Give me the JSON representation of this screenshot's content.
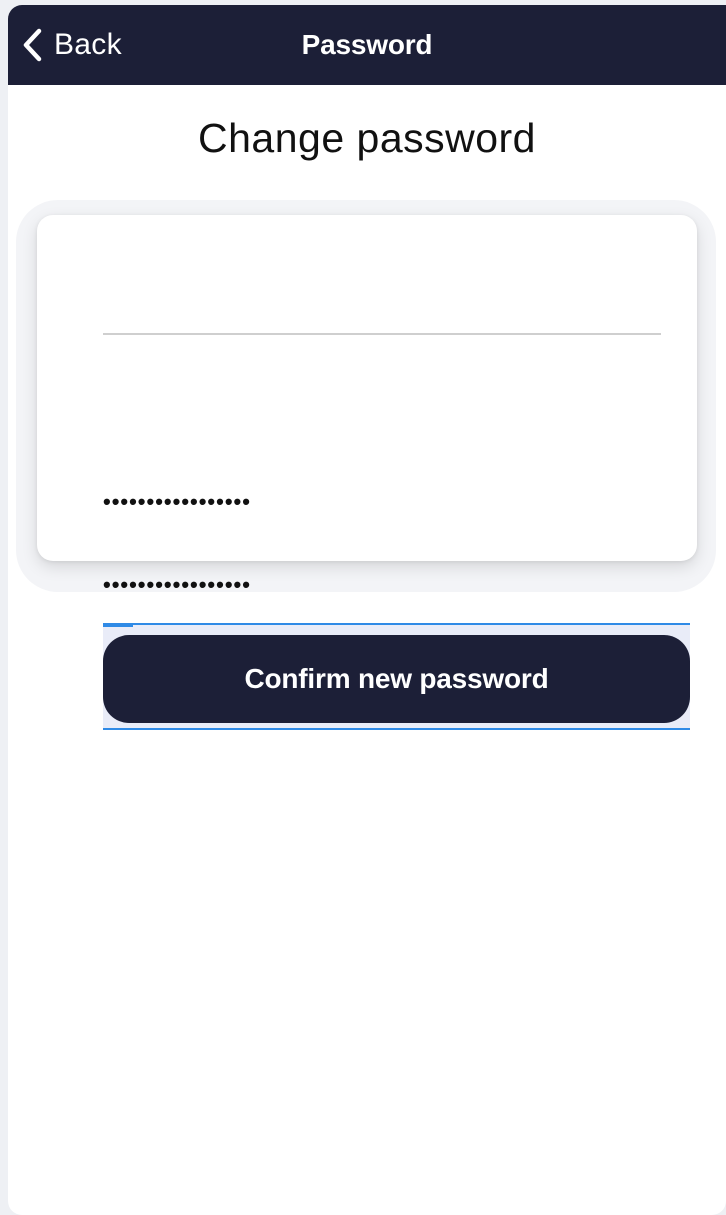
{
  "navbar": {
    "back_label": "Back",
    "title": "Password",
    "background": "#1c1f37"
  },
  "page": {
    "heading": "Change password"
  },
  "form": {
    "password_field_1": {
      "value": "•••••••••••••••••"
    },
    "password_field_2": {
      "value": "•••••••••••••••••"
    },
    "confirm_label": "Confirm new password"
  },
  "icons": {
    "back": "chevron-left-icon"
  },
  "colors": {
    "primary": "#1c1f37",
    "focus": "#2f8ae6"
  }
}
